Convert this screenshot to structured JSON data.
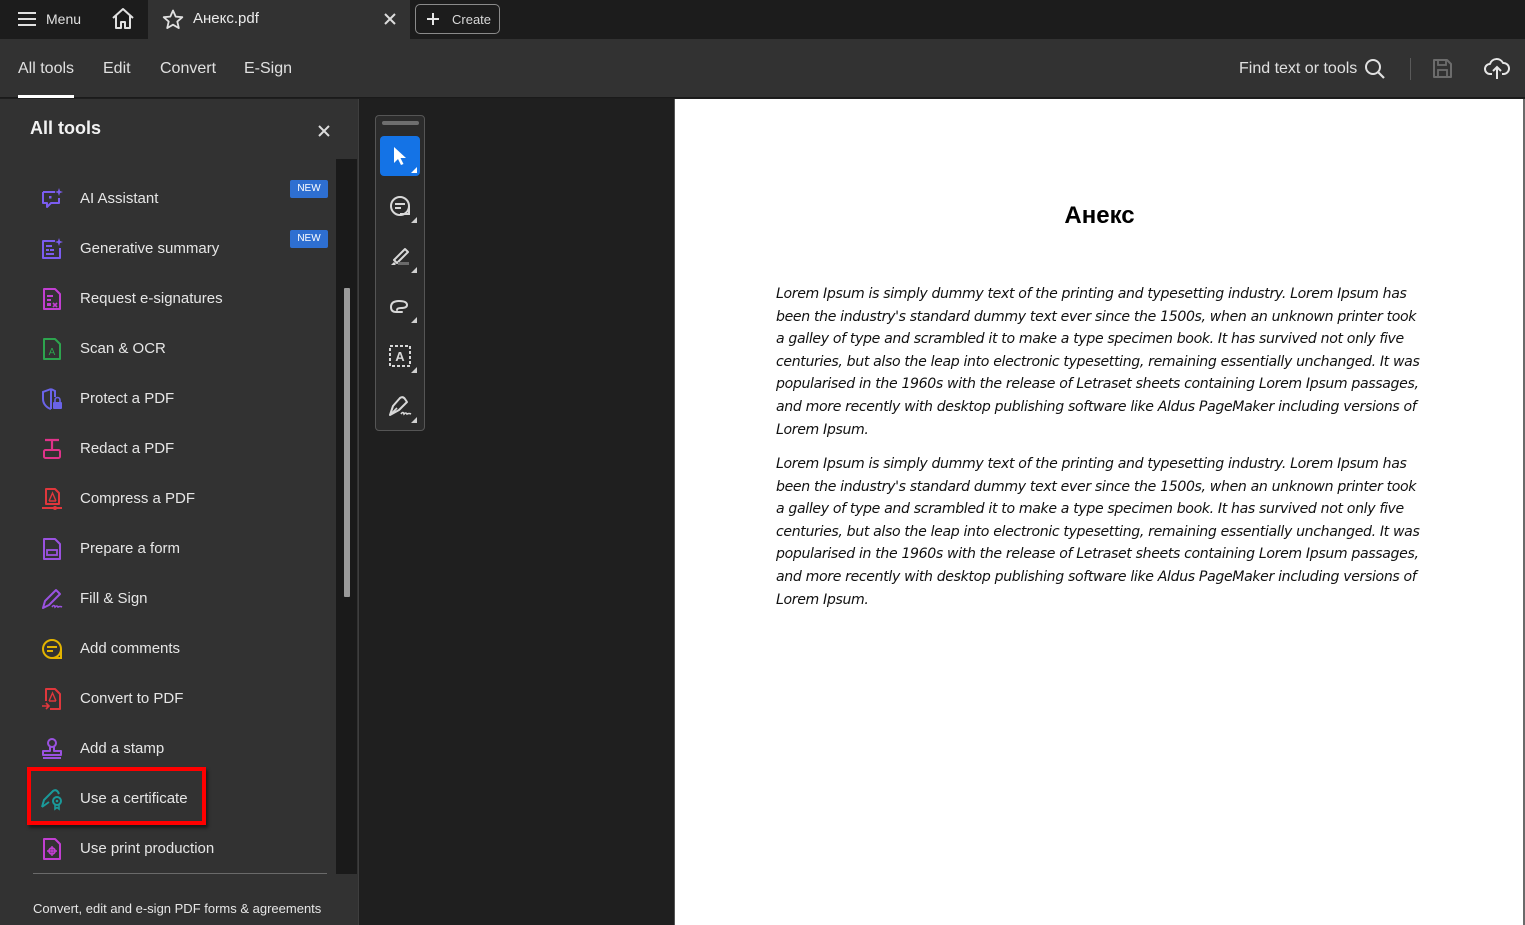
{
  "titlebar": {
    "menu_label": "Menu",
    "document_tab": "Анекс.pdf",
    "create_label": "Create"
  },
  "toolbar": {
    "tabs": [
      {
        "label": "All tools",
        "active": true
      },
      {
        "label": "Edit",
        "active": false
      },
      {
        "label": "Convert",
        "active": false
      },
      {
        "label": "E-Sign",
        "active": false
      }
    ],
    "find_label": "Find text or tools"
  },
  "sidebar": {
    "title": "All tools",
    "items": [
      {
        "label": "AI Assistant",
        "icon": "ai-assistant-icon",
        "color": "#7b5cf0",
        "badge": "NEW"
      },
      {
        "label": "Generative summary",
        "icon": "generative-summary-icon",
        "color": "#7b5cf0",
        "badge": "NEW"
      },
      {
        "label": "Request e-signatures",
        "icon": "request-esignatures-icon",
        "color": "#c13fd1"
      },
      {
        "label": "Scan & OCR",
        "icon": "scan-ocr-icon",
        "color": "#2da44e"
      },
      {
        "label": "Protect a PDF",
        "icon": "protect-pdf-icon",
        "color": "#6a63e8"
      },
      {
        "label": "Redact a PDF",
        "icon": "redact-pdf-icon",
        "color": "#e0338a"
      },
      {
        "label": "Compress a PDF",
        "icon": "compress-pdf-icon",
        "color": "#e0373c"
      },
      {
        "label": "Prepare a form",
        "icon": "prepare-form-icon",
        "color": "#9a52e0"
      },
      {
        "label": "Fill & Sign",
        "icon": "fill-sign-icon",
        "color": "#9a52e0"
      },
      {
        "label": "Add comments",
        "icon": "add-comments-icon",
        "color": "#e3b400"
      },
      {
        "label": "Convert to PDF",
        "icon": "convert-to-pdf-icon",
        "color": "#e0373c"
      },
      {
        "label": "Add a stamp",
        "icon": "add-stamp-icon",
        "color": "#9a52e0"
      },
      {
        "label": "Use a certificate",
        "icon": "use-certificate-icon",
        "color": "#1a9a9a",
        "highlighted": true
      },
      {
        "label": "Use print production",
        "icon": "print-production-icon",
        "color": "#c13fd1"
      }
    ],
    "footer": "Convert, edit and e-sign PDF forms & agreements"
  },
  "quick_tools": [
    {
      "name": "select-tool",
      "active": true
    },
    {
      "name": "comment-tool",
      "active": false
    },
    {
      "name": "highlight-tool",
      "active": false
    },
    {
      "name": "draw-tool",
      "active": false
    },
    {
      "name": "text-recognition-tool",
      "active": false
    },
    {
      "name": "sign-tool",
      "active": false
    }
  ],
  "document": {
    "title": "Анекс",
    "paragraphs": [
      "Lorem Ipsum is simply dummy text of the printing and typesetting industry. Lorem Ipsum has been the industry's standard dummy text ever since the 1500s, when an unknown printer took a galley of type and scrambled it to make a type specimen book. It has survived not only five centuries, but also the leap into electronic typesetting, remaining essentially unchanged. It was popularised in the 1960s with the release of Letraset sheets containing Lorem Ipsum passages, and more recently with desktop publishing software like Aldus PageMaker including versions of Lorem Ipsum.",
      "Lorem Ipsum is simply dummy text of the printing and typesetting industry. Lorem Ipsum has been the industry's standard dummy text ever since the 1500s, when an unknown printer took a galley of type and scrambled it to make a type specimen book. It has survived not only five centuries, but also the leap into electronic typesetting, remaining essentially unchanged. It was popularised in the 1960s with the release of Letraset sheets containing Lorem Ipsum passages, and more recently with desktop publishing software like Aldus PageMaker including versions of Lorem Ipsum."
    ]
  },
  "colors": {
    "accent": "#1473e6",
    "badge": "#2e6fd1",
    "highlight_box": "#ff0000"
  }
}
